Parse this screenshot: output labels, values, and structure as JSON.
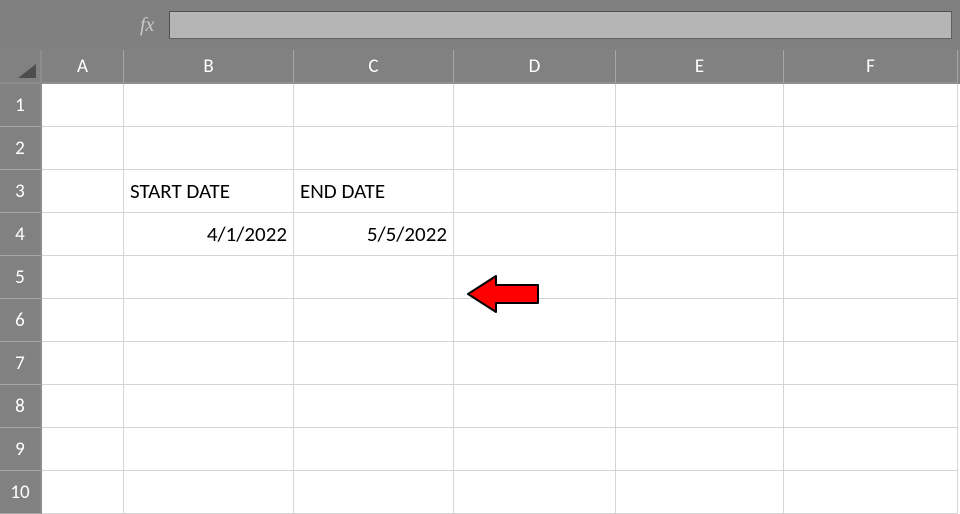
{
  "formulaBar": {
    "fxLabel": "fx",
    "value": ""
  },
  "columns": [
    {
      "id": "A",
      "label": "A",
      "widthClass": "colA"
    },
    {
      "id": "B",
      "label": "B",
      "widthClass": "colB"
    },
    {
      "id": "C",
      "label": "C",
      "widthClass": "colC"
    },
    {
      "id": "D",
      "label": "D",
      "widthClass": "colD"
    },
    {
      "id": "E",
      "label": "E",
      "widthClass": "colE"
    },
    {
      "id": "F",
      "label": "F",
      "widthClass": "colF"
    }
  ],
  "rows": [
    {
      "num": "1"
    },
    {
      "num": "2"
    },
    {
      "num": "3"
    },
    {
      "num": "4"
    },
    {
      "num": "5"
    },
    {
      "num": "6"
    },
    {
      "num": "7"
    },
    {
      "num": "8"
    },
    {
      "num": "9"
    },
    {
      "num": "10"
    }
  ],
  "cells": {
    "B3": {
      "value": "START DATE",
      "align": "text"
    },
    "C3": {
      "value": "END DATE",
      "align": "text"
    },
    "B4": {
      "value": "4/1/2022",
      "align": "num"
    },
    "C4": {
      "value": "5/5/2022",
      "align": "num"
    }
  },
  "annotation": {
    "type": "arrow-left",
    "color": "#ff0000",
    "stroke": "#000000",
    "pointsToCell": "C4"
  }
}
